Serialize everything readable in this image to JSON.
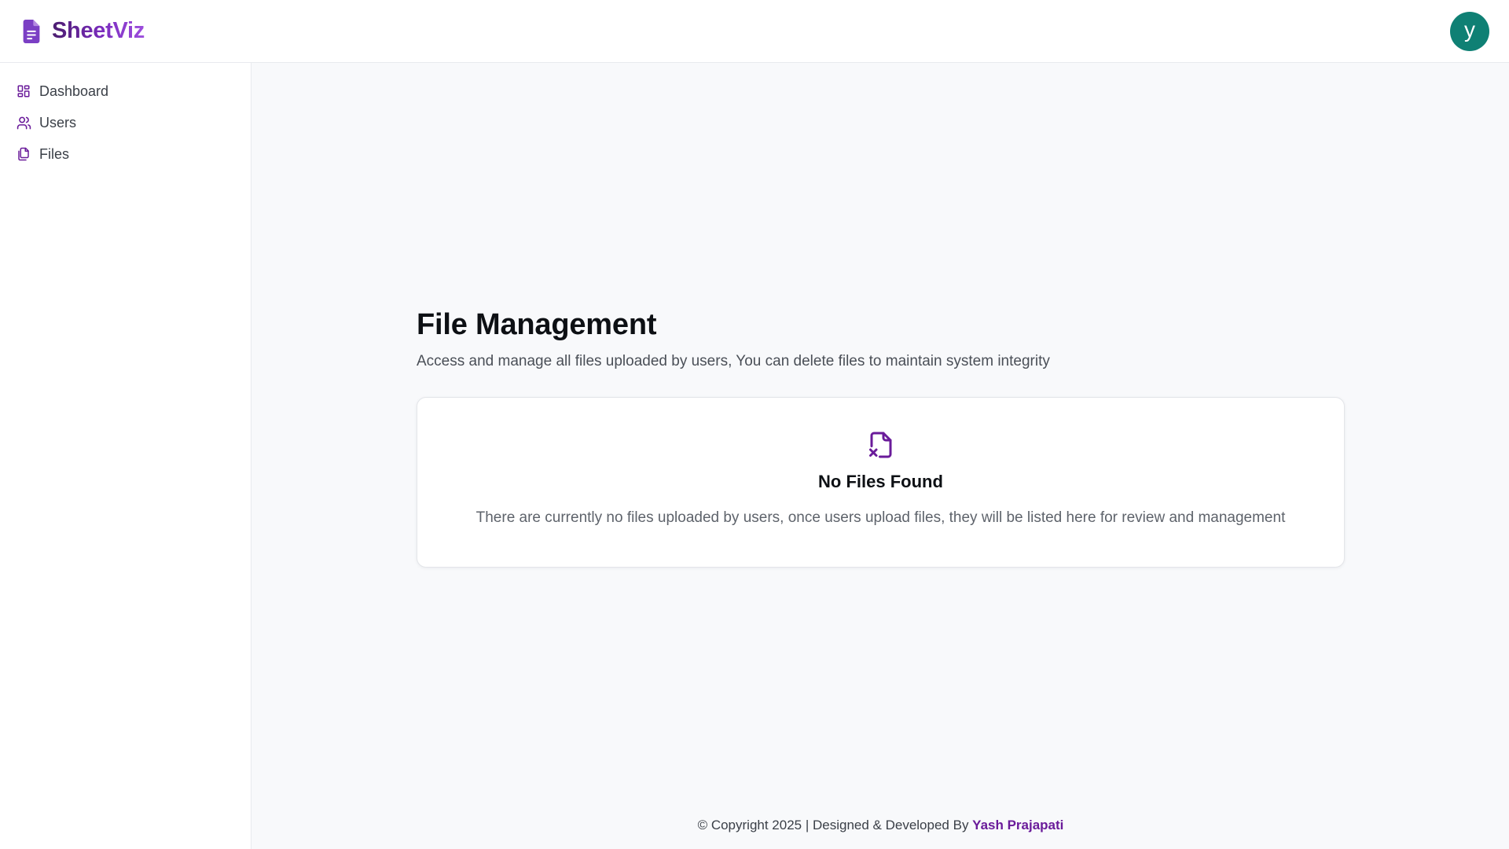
{
  "app": {
    "name": "SheetViz",
    "logo_icon": "document-icon",
    "brand_colors": [
      "#4b1d6f",
      "#7b2cbf",
      "#9d4edd"
    ]
  },
  "user": {
    "avatar_initial": "y",
    "avatar_color": "#0f8074"
  },
  "sidebar": {
    "items": [
      {
        "label": "Dashboard",
        "icon": "dashboard-grid-icon"
      },
      {
        "label": "Users",
        "icon": "users-icon"
      },
      {
        "label": "Files",
        "icon": "files-icon"
      }
    ]
  },
  "main": {
    "title": "File Management",
    "subtitle": "Access and manage all files uploaded by users, You can delete files to maintain system integrity",
    "empty_state": {
      "icon": "file-x-icon",
      "title": "No Files Found",
      "text": "There are currently no files uploaded by users, once users upload files, they will be listed here for review and management"
    }
  },
  "footer": {
    "text": "© Copyright 2025 | Designed & Developed By ",
    "author": "Yash Prajapati"
  },
  "accent_color": "#6a1b9a"
}
